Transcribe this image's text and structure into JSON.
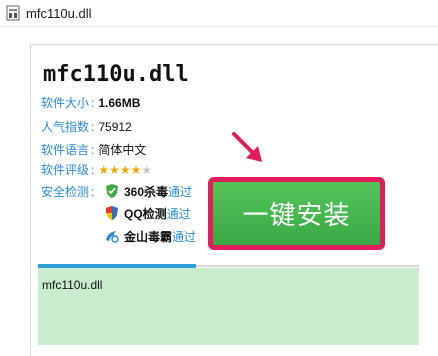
{
  "window": {
    "title": "mfc110u.dll"
  },
  "file": {
    "name": "mfc110u.dll"
  },
  "info": {
    "size_label": "软件大小",
    "size_value": "1.66MB",
    "popularity_label": "人气指数",
    "popularity_value": "75912",
    "language_label": "软件语言",
    "language_value": "简体中文",
    "rating_label": "软件评级",
    "rating_stars": 4,
    "rating_max": 5,
    "security_label": "安全检测",
    "separator": ":"
  },
  "security": [
    {
      "name": "360杀毒",
      "status": "通过",
      "icon": "360-shield-icon"
    },
    {
      "name": "QQ检测",
      "status": "通过",
      "icon": "qq-shield-icon"
    },
    {
      "name": "金山毒霸",
      "status": "通过",
      "icon": "jinshan-icon"
    }
  ],
  "install_button": {
    "label": "一键安装"
  },
  "tab_area": {
    "text": "mfc110u.dll"
  },
  "colors": {
    "accent_blue": "#2b8ad6",
    "button_green": "#44b24e",
    "highlight_pink": "#e11d5c",
    "panel_green": "#c9ecce"
  }
}
